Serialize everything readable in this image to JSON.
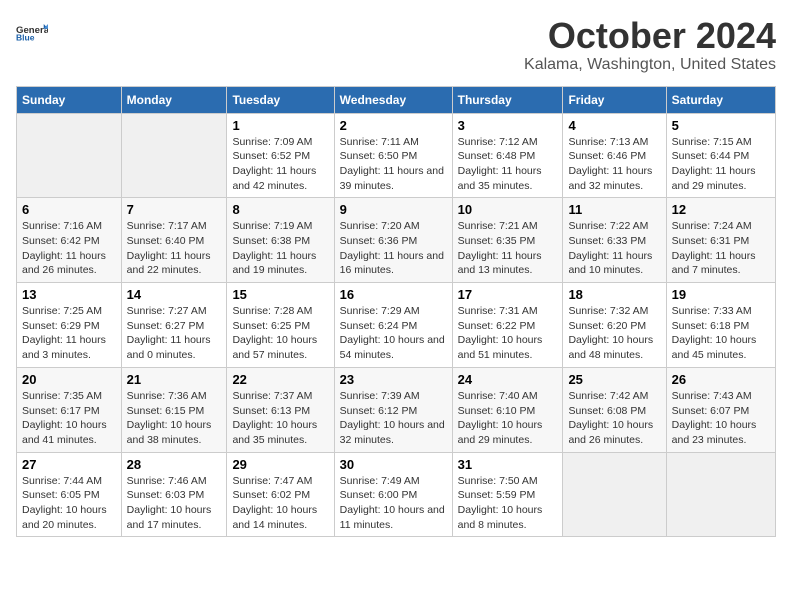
{
  "logo": {
    "line1": "General",
    "line2": "Blue"
  },
  "title": "October 2024",
  "subtitle": "Kalama, Washington, United States",
  "days_of_week": [
    "Sunday",
    "Monday",
    "Tuesday",
    "Wednesday",
    "Thursday",
    "Friday",
    "Saturday"
  ],
  "weeks": [
    [
      {
        "day": "",
        "info": ""
      },
      {
        "day": "",
        "info": ""
      },
      {
        "day": "1",
        "info": "Sunrise: 7:09 AM\nSunset: 6:52 PM\nDaylight: 11 hours and 42 minutes."
      },
      {
        "day": "2",
        "info": "Sunrise: 7:11 AM\nSunset: 6:50 PM\nDaylight: 11 hours and 39 minutes."
      },
      {
        "day": "3",
        "info": "Sunrise: 7:12 AM\nSunset: 6:48 PM\nDaylight: 11 hours and 35 minutes."
      },
      {
        "day": "4",
        "info": "Sunrise: 7:13 AM\nSunset: 6:46 PM\nDaylight: 11 hours and 32 minutes."
      },
      {
        "day": "5",
        "info": "Sunrise: 7:15 AM\nSunset: 6:44 PM\nDaylight: 11 hours and 29 minutes."
      }
    ],
    [
      {
        "day": "6",
        "info": "Sunrise: 7:16 AM\nSunset: 6:42 PM\nDaylight: 11 hours and 26 minutes."
      },
      {
        "day": "7",
        "info": "Sunrise: 7:17 AM\nSunset: 6:40 PM\nDaylight: 11 hours and 22 minutes."
      },
      {
        "day": "8",
        "info": "Sunrise: 7:19 AM\nSunset: 6:38 PM\nDaylight: 11 hours and 19 minutes."
      },
      {
        "day": "9",
        "info": "Sunrise: 7:20 AM\nSunset: 6:36 PM\nDaylight: 11 hours and 16 minutes."
      },
      {
        "day": "10",
        "info": "Sunrise: 7:21 AM\nSunset: 6:35 PM\nDaylight: 11 hours and 13 minutes."
      },
      {
        "day": "11",
        "info": "Sunrise: 7:22 AM\nSunset: 6:33 PM\nDaylight: 11 hours and 10 minutes."
      },
      {
        "day": "12",
        "info": "Sunrise: 7:24 AM\nSunset: 6:31 PM\nDaylight: 11 hours and 7 minutes."
      }
    ],
    [
      {
        "day": "13",
        "info": "Sunrise: 7:25 AM\nSunset: 6:29 PM\nDaylight: 11 hours and 3 minutes."
      },
      {
        "day": "14",
        "info": "Sunrise: 7:27 AM\nSunset: 6:27 PM\nDaylight: 11 hours and 0 minutes."
      },
      {
        "day": "15",
        "info": "Sunrise: 7:28 AM\nSunset: 6:25 PM\nDaylight: 10 hours and 57 minutes."
      },
      {
        "day": "16",
        "info": "Sunrise: 7:29 AM\nSunset: 6:24 PM\nDaylight: 10 hours and 54 minutes."
      },
      {
        "day": "17",
        "info": "Sunrise: 7:31 AM\nSunset: 6:22 PM\nDaylight: 10 hours and 51 minutes."
      },
      {
        "day": "18",
        "info": "Sunrise: 7:32 AM\nSunset: 6:20 PM\nDaylight: 10 hours and 48 minutes."
      },
      {
        "day": "19",
        "info": "Sunrise: 7:33 AM\nSunset: 6:18 PM\nDaylight: 10 hours and 45 minutes."
      }
    ],
    [
      {
        "day": "20",
        "info": "Sunrise: 7:35 AM\nSunset: 6:17 PM\nDaylight: 10 hours and 41 minutes."
      },
      {
        "day": "21",
        "info": "Sunrise: 7:36 AM\nSunset: 6:15 PM\nDaylight: 10 hours and 38 minutes."
      },
      {
        "day": "22",
        "info": "Sunrise: 7:37 AM\nSunset: 6:13 PM\nDaylight: 10 hours and 35 minutes."
      },
      {
        "day": "23",
        "info": "Sunrise: 7:39 AM\nSunset: 6:12 PM\nDaylight: 10 hours and 32 minutes."
      },
      {
        "day": "24",
        "info": "Sunrise: 7:40 AM\nSunset: 6:10 PM\nDaylight: 10 hours and 29 minutes."
      },
      {
        "day": "25",
        "info": "Sunrise: 7:42 AM\nSunset: 6:08 PM\nDaylight: 10 hours and 26 minutes."
      },
      {
        "day": "26",
        "info": "Sunrise: 7:43 AM\nSunset: 6:07 PM\nDaylight: 10 hours and 23 minutes."
      }
    ],
    [
      {
        "day": "27",
        "info": "Sunrise: 7:44 AM\nSunset: 6:05 PM\nDaylight: 10 hours and 20 minutes."
      },
      {
        "day": "28",
        "info": "Sunrise: 7:46 AM\nSunset: 6:03 PM\nDaylight: 10 hours and 17 minutes."
      },
      {
        "day": "29",
        "info": "Sunrise: 7:47 AM\nSunset: 6:02 PM\nDaylight: 10 hours and 14 minutes."
      },
      {
        "day": "30",
        "info": "Sunrise: 7:49 AM\nSunset: 6:00 PM\nDaylight: 10 hours and 11 minutes."
      },
      {
        "day": "31",
        "info": "Sunrise: 7:50 AM\nSunset: 5:59 PM\nDaylight: 10 hours and 8 minutes."
      },
      {
        "day": "",
        "info": ""
      },
      {
        "day": "",
        "info": ""
      }
    ]
  ]
}
